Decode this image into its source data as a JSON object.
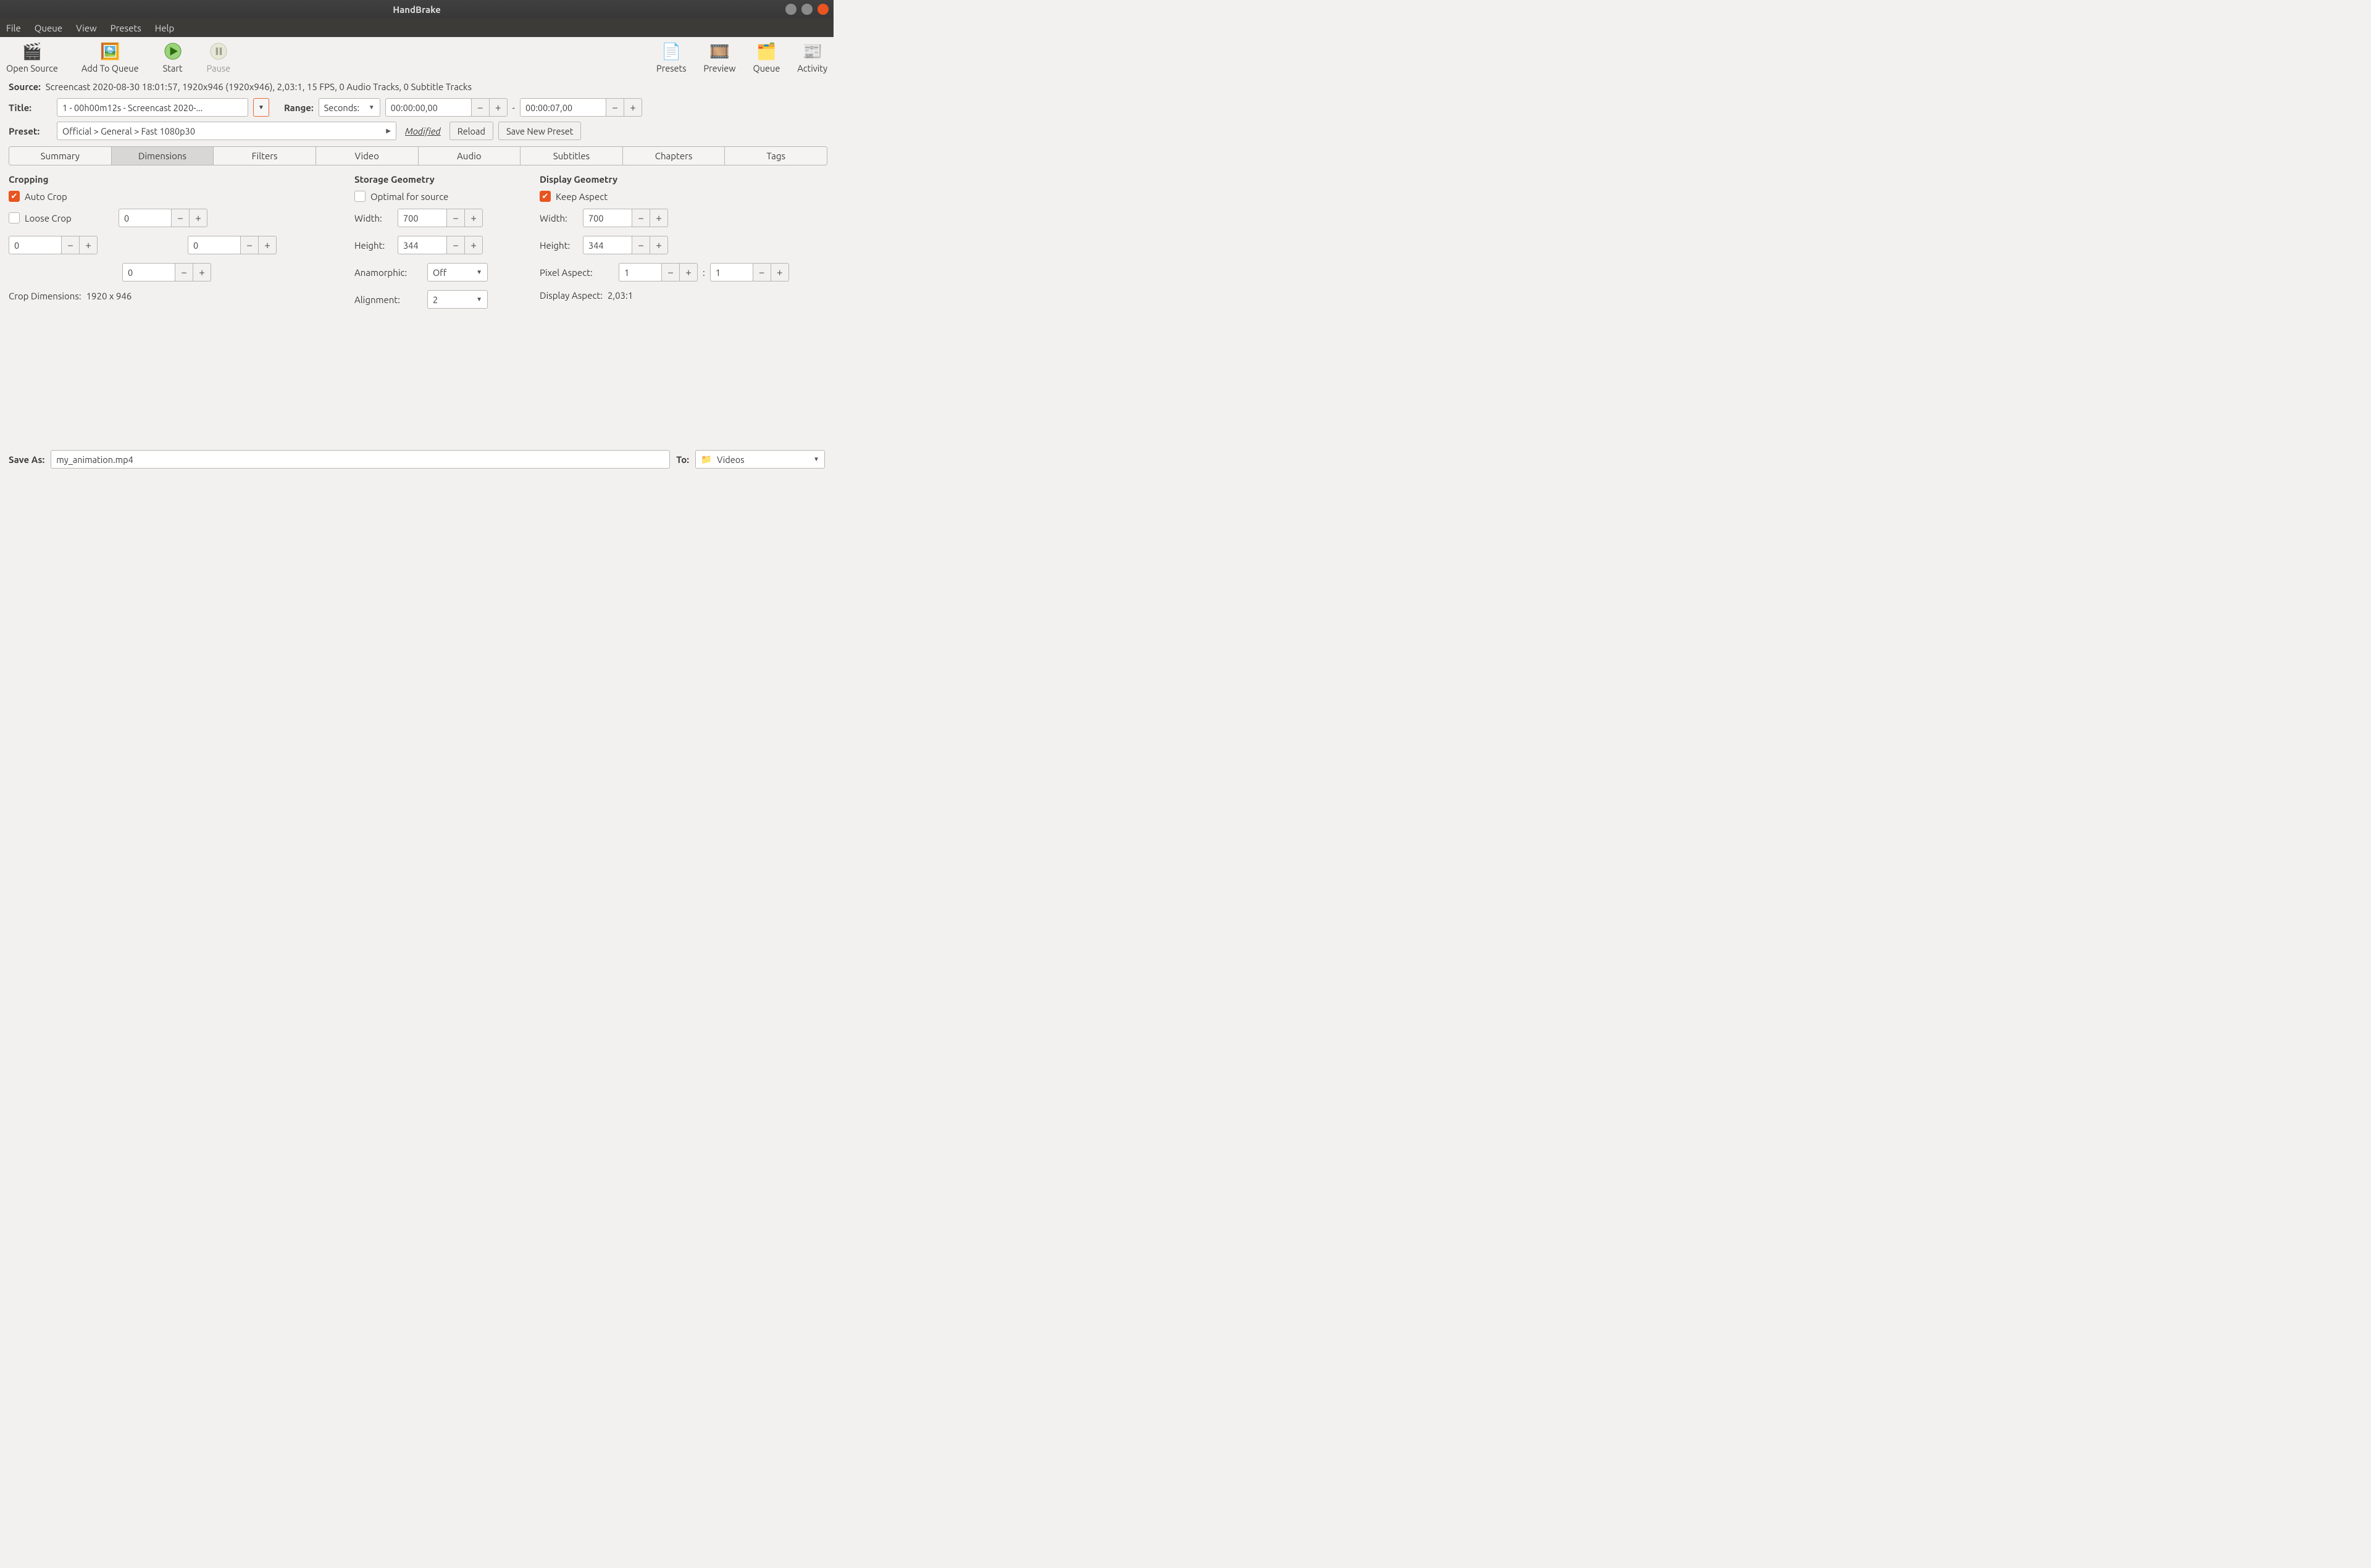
{
  "window": {
    "title": "HandBrake"
  },
  "menu": {
    "file": "File",
    "queue": "Queue",
    "view": "View",
    "presets": "Presets",
    "help": "Help"
  },
  "toolbar": {
    "open_source": "Open Source",
    "add_to_queue": "Add To Queue",
    "start": "Start",
    "pause": "Pause",
    "presets": "Presets",
    "preview": "Preview",
    "queue": "Queue",
    "activity": "Activity"
  },
  "source": {
    "label": "Source:",
    "value": "Screencast 2020-08-30 18:01:57, 1920x946 (1920x946), 2,03:1, 15 FPS, 0 Audio Tracks, 0 Subtitle Tracks"
  },
  "title": {
    "label": "Title:",
    "value": "1 - 00h00m12s - Screencast 2020-..."
  },
  "range": {
    "label": "Range:",
    "mode": "Seconds:",
    "start": "00:00:00,00",
    "sep": "-",
    "end": "00:00:07,00"
  },
  "preset": {
    "label": "Preset:",
    "value": "Official > General > Fast 1080p30",
    "modified": "Modified",
    "reload": "Reload",
    "save_new": "Save New Preset"
  },
  "tabs": {
    "summary": "Summary",
    "dimensions": "Dimensions",
    "filters": "Filters",
    "video": "Video",
    "audio": "Audio",
    "subtitles": "Subtitles",
    "chapters": "Chapters",
    "tags": "Tags"
  },
  "cropping": {
    "header": "Cropping",
    "auto": "Auto Crop",
    "loose": "Loose Crop",
    "loose_val": "0",
    "top": "0",
    "left": "0",
    "right": "0",
    "bottom": "0",
    "dims_label": "Crop Dimensions:",
    "dims_value": "1920 x 946"
  },
  "storage": {
    "header": "Storage Geometry",
    "optimal": "Optimal for source",
    "width_label": "Width:",
    "width": "700",
    "height_label": "Height:",
    "height": "344",
    "anamorphic_label": "Anamorphic:",
    "anamorphic": "Off",
    "alignment_label": "Alignment:",
    "alignment": "2"
  },
  "display": {
    "header": "Display Geometry",
    "keep_aspect": "Keep Aspect",
    "width_label": "Width:",
    "width": "700",
    "height_label": "Height:",
    "height": "344",
    "pixel_aspect_label": "Pixel Aspect:",
    "par_n": "1",
    "par_sep": ":",
    "par_d": "1",
    "display_aspect_label": "Display Aspect:",
    "display_aspect_value": "2,03:1"
  },
  "saveas": {
    "label": "Save As:",
    "value": "my_animation.mp4",
    "to_label": "To:",
    "to_value": "Videos"
  }
}
